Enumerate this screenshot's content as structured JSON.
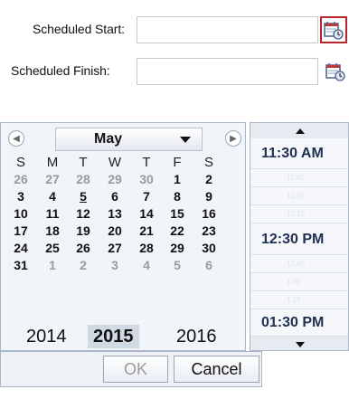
{
  "form": {
    "start_label": "Scheduled Start:",
    "finish_label": "Scheduled Finish:",
    "start_value": "",
    "finish_value": ""
  },
  "calendar": {
    "prev_icon": "◀",
    "next_icon": "▶",
    "month": "May",
    "weekdays": [
      "S",
      "M",
      "T",
      "W",
      "T",
      "F",
      "S"
    ],
    "weeks": [
      [
        {
          "d": "26",
          "m": true
        },
        {
          "d": "27",
          "m": true
        },
        {
          "d": "28",
          "m": true
        },
        {
          "d": "29",
          "m": true
        },
        {
          "d": "30",
          "m": true
        },
        {
          "d": "1"
        },
        {
          "d": "2"
        }
      ],
      [
        {
          "d": "3"
        },
        {
          "d": "4"
        },
        {
          "d": "5",
          "today": true
        },
        {
          "d": "6"
        },
        {
          "d": "7"
        },
        {
          "d": "8"
        },
        {
          "d": "9"
        }
      ],
      [
        {
          "d": "10"
        },
        {
          "d": "11"
        },
        {
          "d": "12"
        },
        {
          "d": "13"
        },
        {
          "d": "14"
        },
        {
          "d": "15"
        },
        {
          "d": "16"
        }
      ],
      [
        {
          "d": "17"
        },
        {
          "d": "18"
        },
        {
          "d": "19"
        },
        {
          "d": "20"
        },
        {
          "d": "21"
        },
        {
          "d": "22"
        },
        {
          "d": "23"
        }
      ],
      [
        {
          "d": "24"
        },
        {
          "d": "25"
        },
        {
          "d": "26"
        },
        {
          "d": "27"
        },
        {
          "d": "28"
        },
        {
          "d": "29"
        },
        {
          "d": "30"
        }
      ],
      [
        {
          "d": "31"
        },
        {
          "d": "1",
          "m": true
        },
        {
          "d": "2",
          "m": true
        },
        {
          "d": "3",
          "m": true
        },
        {
          "d": "4",
          "m": true
        },
        {
          "d": "5",
          "m": true
        },
        {
          "d": "6",
          "m": true
        }
      ]
    ],
    "years": [
      {
        "label": "2014"
      },
      {
        "label": "2015",
        "selected": true
      },
      {
        "label": "2016"
      }
    ]
  },
  "time": {
    "slots": [
      {
        "label": "11:30 AM",
        "major": true
      },
      {
        "label": "11:45",
        "major": false
      },
      {
        "label": "12:00",
        "major": false
      },
      {
        "label": "12:15",
        "major": false
      },
      {
        "label": "12:30 PM",
        "major": true
      },
      {
        "label": "12:45",
        "major": false
      },
      {
        "label": "1:00",
        "major": false
      },
      {
        "label": "1:15",
        "major": false
      },
      {
        "label": "01:30 PM",
        "major": true
      }
    ]
  },
  "buttons": {
    "ok": "OK",
    "cancel": "Cancel"
  },
  "colors": {
    "highlight_border": "#b5272d",
    "selected_year_bg": "#d1d9e3",
    "panel_border": "#aab7c9"
  }
}
